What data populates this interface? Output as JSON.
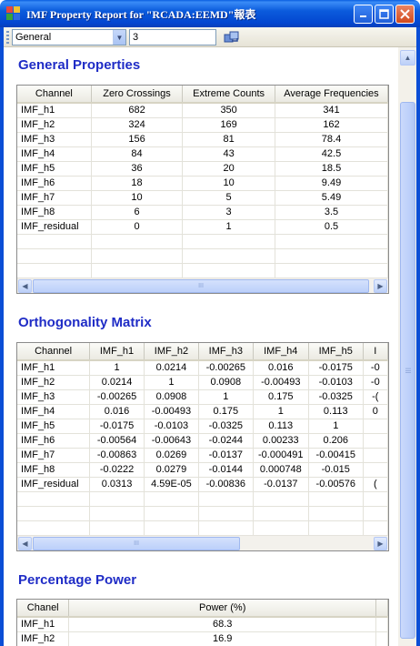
{
  "window": {
    "title": "IMF Property Report for \"RCADA:EEMD\"報表",
    "icon": "app-icon"
  },
  "toolbar": {
    "combo_value": "General",
    "number_value": "3",
    "refresh_icon": "refresh-icon"
  },
  "general": {
    "title": "General Properties",
    "columns": [
      "Channel",
      "Zero Crossings",
      "Extreme Counts",
      "Average Frequencies"
    ],
    "rows": [
      [
        "IMF_h1",
        "682",
        "350",
        "341"
      ],
      [
        "IMF_h2",
        "324",
        "169",
        "162"
      ],
      [
        "IMF_h3",
        "156",
        "81",
        "78.4"
      ],
      [
        "IMF_h4",
        "84",
        "43",
        "42.5"
      ],
      [
        "IMF_h5",
        "36",
        "20",
        "18.5"
      ],
      [
        "IMF_h6",
        "18",
        "10",
        "9.49"
      ],
      [
        "IMF_h7",
        "10",
        "5",
        "5.49"
      ],
      [
        "IMF_h8",
        "6",
        "3",
        "3.5"
      ],
      [
        "IMF_residual",
        "0",
        "1",
        "0.5"
      ]
    ]
  },
  "orthogonality": {
    "title": "Orthogonality Matrix",
    "columns": [
      "Channel",
      "IMF_h1",
      "IMF_h2",
      "IMF_h3",
      "IMF_h4",
      "IMF_h5",
      "I"
    ],
    "rows": [
      [
        "IMF_h1",
        "1",
        "0.0214",
        "-0.00265",
        "0.016",
        "-0.0175",
        "-0"
      ],
      [
        "IMF_h2",
        "0.0214",
        "1",
        "0.0908",
        "-0.00493",
        "-0.0103",
        "-0"
      ],
      [
        "IMF_h3",
        "-0.00265",
        "0.0908",
        "1",
        "0.175",
        "-0.0325",
        "-("
      ],
      [
        "IMF_h4",
        "0.016",
        "-0.00493",
        "0.175",
        "1",
        "0.113",
        "0"
      ],
      [
        "IMF_h5",
        "-0.0175",
        "-0.0103",
        "-0.0325",
        "0.113",
        "1",
        ""
      ],
      [
        "IMF_h6",
        "-0.00564",
        "-0.00643",
        "-0.0244",
        "0.00233",
        "0.206",
        ""
      ],
      [
        "IMF_h7",
        "-0.00863",
        "0.0269",
        "-0.0137",
        "-0.000491",
        "-0.00415",
        ""
      ],
      [
        "IMF_h8",
        "-0.0222",
        "0.0279",
        "-0.0144",
        "0.000748",
        "-0.015",
        ""
      ],
      [
        "IMF_residual",
        "0.0313",
        "4.59E-05",
        "-0.00836",
        "-0.0137",
        "-0.00576",
        "("
      ]
    ]
  },
  "power": {
    "title": "Percentage Power",
    "columns": [
      "Chanel",
      "Power (%)"
    ],
    "rows": [
      [
        "IMF_h1",
        "68.3"
      ],
      [
        "IMF_h2",
        "16.9"
      ]
    ]
  },
  "scrollbar": {
    "thumb_grip": "III"
  }
}
